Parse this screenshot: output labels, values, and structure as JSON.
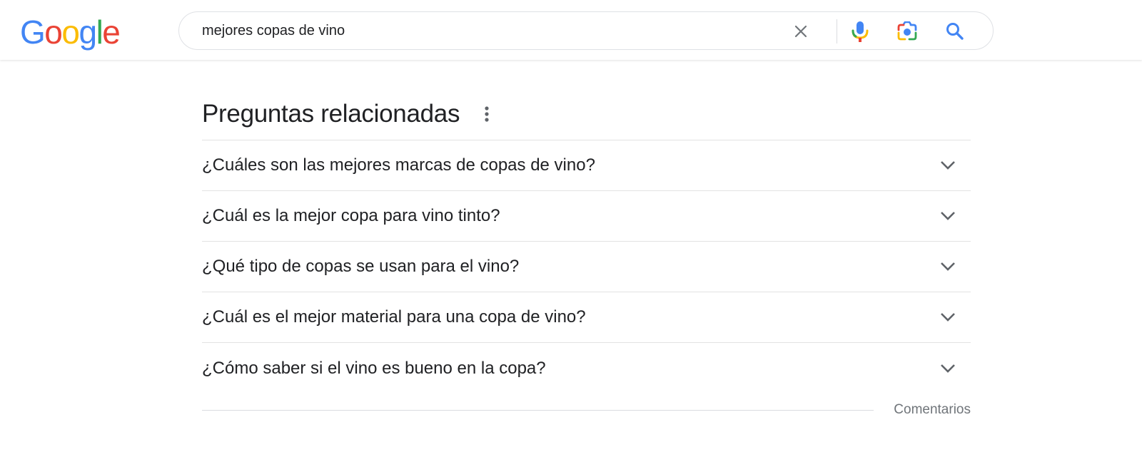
{
  "header": {
    "logo": {
      "letters": [
        "G",
        "o",
        "o",
        "g",
        "l",
        "e"
      ],
      "colors": [
        "#4285F4",
        "#EA4335",
        "#FBBC05",
        "#4285F4",
        "#34A853",
        "#EA4335"
      ]
    },
    "search": {
      "query": "mejores copas de vino",
      "icons": [
        "close-icon",
        "microphone-icon",
        "camera-lens-icon",
        "search-icon"
      ]
    }
  },
  "paa": {
    "title": "Preguntas relacionadas",
    "menu_icon": "more-vert-icon",
    "questions": [
      "¿Cuáles son las mejores marcas de copas de vino?",
      "¿Cuál es la mejor copa para vino tinto?",
      "¿Qué tipo de copas se usan para el vino?",
      "¿Cuál es el mejor material para una copa de vino?",
      "¿Cómo saber si el vino es bueno en la copa?"
    ],
    "expand_icon": "chevron-down-icon",
    "feedback_label": "Comentarios"
  },
  "colors": {
    "text": "#202124",
    "secondary_text": "#70757a",
    "divider": "#e3e3e3",
    "search_blue": "#4285F4"
  }
}
